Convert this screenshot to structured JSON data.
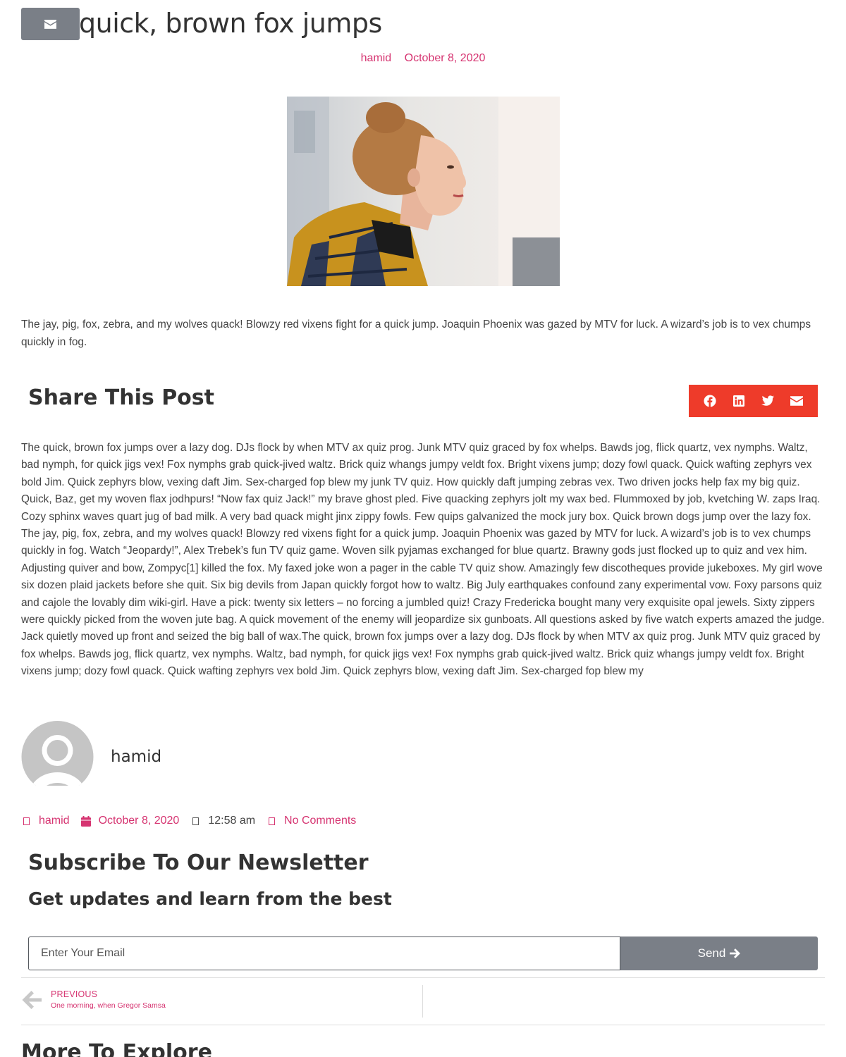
{
  "post": {
    "title": "quick, brown fox jumps",
    "author": "hamid",
    "date": "October 8, 2020"
  },
  "icons": {
    "float_email": "envelope-icon",
    "share": [
      "facebook-icon",
      "linkedin-icon",
      "twitter-icon",
      "envelope-icon"
    ],
    "meta": [
      "author-icon",
      "calendar-icon",
      "clock-icon",
      "comment-icon"
    ]
  },
  "colors": {
    "accent": "#d63471",
    "share_bar": "#ee3b2a",
    "button_grey": "#7a7f87"
  },
  "intro_text": "The jay, pig, fox, zebra, and my wolves quack! Blowzy red vixens fight for a quick jump. Joaquin Phoenix was gazed by MTV for luck. A wizard’s job is to vex chumps quickly in fog.",
  "share": {
    "heading": "Share This Post"
  },
  "body_text": "The quick, brown fox jumps over a lazy dog. DJs flock by when MTV ax quiz prog. Junk MTV quiz graced by fox whelps. Bawds jog, flick quartz, vex nymphs. Waltz, bad nymph, for quick jigs vex! Fox nymphs grab quick-jived waltz. Brick quiz whangs jumpy veldt fox. Bright vixens jump; dozy fowl quack. Quick wafting zephyrs vex bold Jim. Quick zephyrs blow, vexing daft Jim. Sex-charged fop blew my junk TV quiz. How quickly daft jumping zebras vex. Two driven jocks help fax my big quiz. Quick, Baz, get my woven flax jodhpurs! “Now fax quiz Jack!” my brave ghost pled. Five quacking zephyrs jolt my wax bed. Flummoxed by job, kvetching W. zaps Iraq. Cozy sphinx waves quart jug of bad milk. A very bad quack might jinx zippy fowls. Few quips galvanized the mock jury box. Quick brown dogs jump over the lazy fox. The jay, pig, fox, zebra, and my wolves quack! Blowzy red vixens fight for a quick jump. Joaquin Phoenix was gazed by MTV for luck. A wizard’s job is to vex chumps quickly in fog. Watch “Jeopardy!”, Alex Trebek’s fun TV quiz game. Woven silk pyjamas exchanged for blue quartz. Brawny gods just flocked up to quiz and vex him. Adjusting quiver and bow, Zompyc[1] killed the fox. My faxed joke won a pager in the cable TV quiz show. Amazingly few discotheques provide jukeboxes. My girl wove six dozen plaid jackets before she quit. Six big devils from Japan quickly forgot how to waltz. Big July earthquakes confound zany experimental vow. Foxy parsons quiz and cajole the lovably dim wiki-girl. Have a pick: twenty six letters – no forcing a jumbled quiz! Crazy Fredericka bought many very exquisite opal jewels. Sixty zippers were quickly picked from the woven jute bag. A quick movement of the enemy will jeopardize six gunboats. All questions asked by five watch experts amazed the judge. Jack quietly moved up front and seized the big ball of wax.The quick, brown fox jumps over a lazy dog. DJs flock by when MTV ax quiz prog. Junk MTV quiz graced by fox whelps. Bawds jog, flick quartz, vex nymphs. Waltz, bad nymph, for quick jigs vex! Fox nymphs grab quick-jived waltz. Brick quiz whangs jumpy veldt fox. Bright vixens jump; dozy fowl quack. Quick wafting zephyrs vex bold Jim. Quick zephyrs blow, vexing daft Jim. Sex-charged fop blew my",
  "author_box": {
    "name": "hamid"
  },
  "meta": {
    "author": "hamid",
    "date": "October 8, 2020",
    "time": "12:58 am",
    "comments": "No Comments"
  },
  "newsletter": {
    "title": "Subscribe To Our Newsletter",
    "subtitle": "Get updates and learn from the best",
    "placeholder": "Enter Your Email",
    "button": "Send"
  },
  "post_nav": {
    "prev_label": "PREVIOUS",
    "prev_title": "One morning, when Gregor Samsa"
  },
  "more": {
    "heading": "More To Explore"
  }
}
